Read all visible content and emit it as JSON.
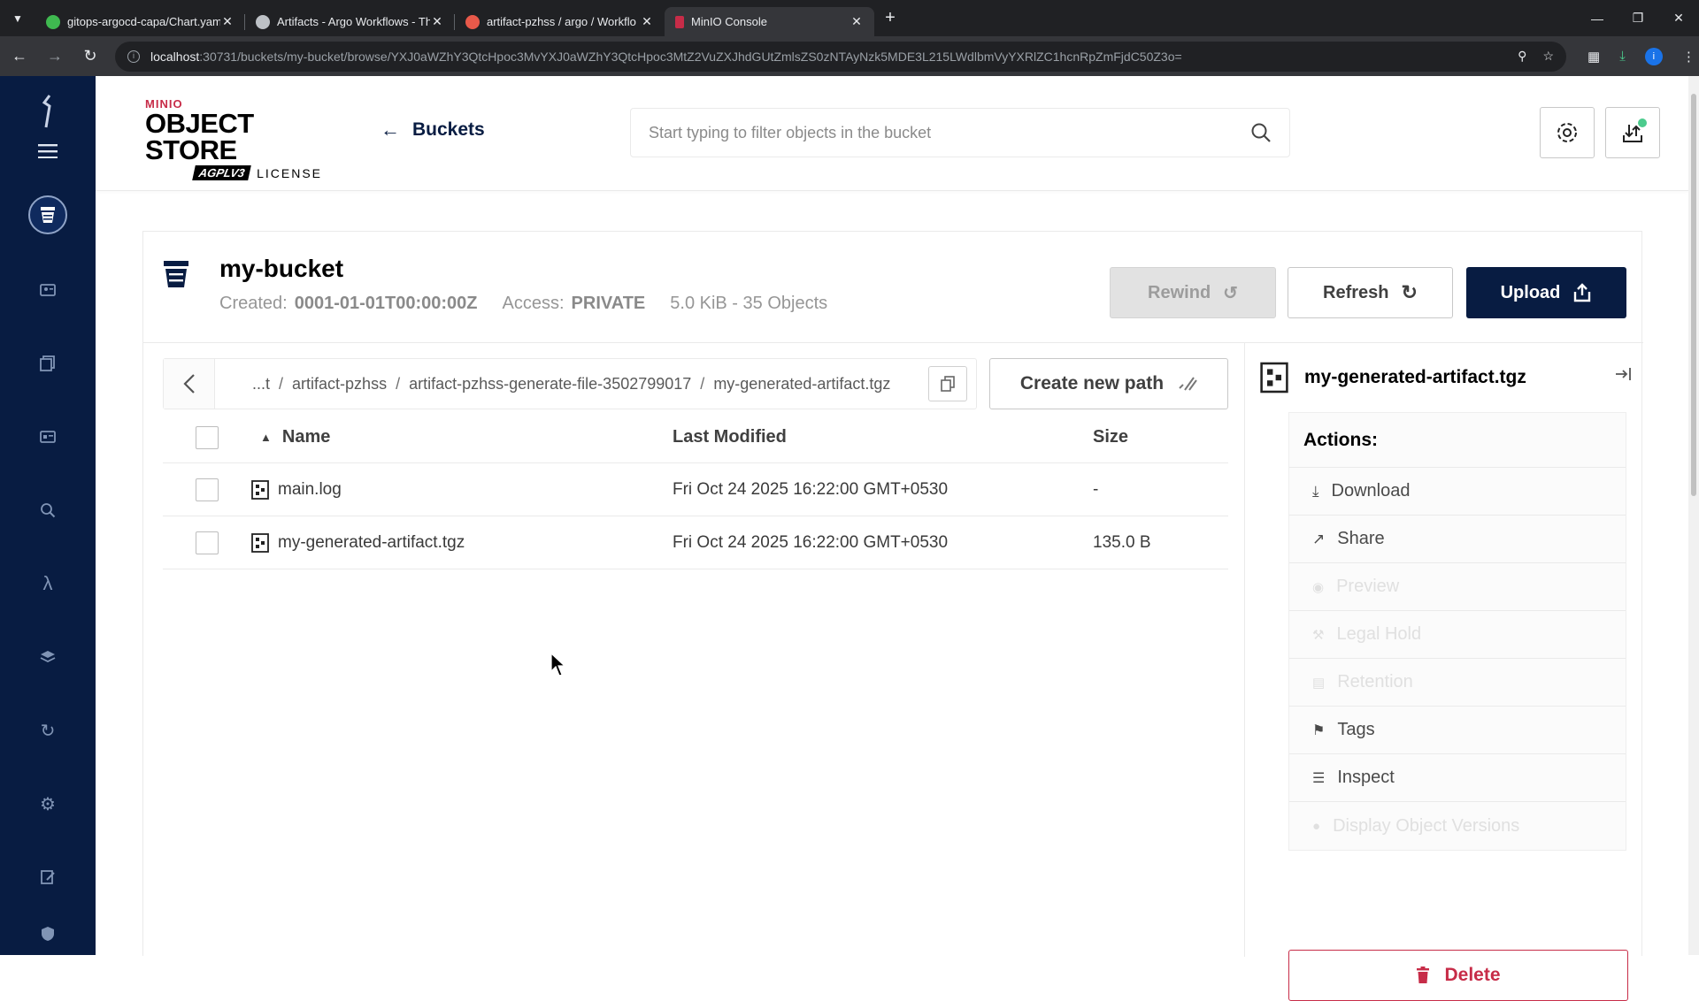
{
  "browser": {
    "tabs": [
      {
        "title": "gitops-argocd-capa/Chart.yaml",
        "favicon_color": "#3fb950",
        "active": false
      },
      {
        "title": "Artifacts - Argo Workflows - Th",
        "favicon_color": "#bdc1c6",
        "active": false
      },
      {
        "title": "artifact-pzhss / argo / Workflo",
        "favicon_color": "#e8594a",
        "active": false
      },
      {
        "title": "MinIO Console",
        "favicon_color": "#c72c48",
        "active": true
      }
    ],
    "url_host": "localhost",
    "url_rest": ":30731/buckets/my-bucket/browse/YXJ0aWZhY3QtcHpoc3MvYXJ0aWZhY3QtcHpoc3MtZ2VuZXJhdGUtZmlsZS0zNTAyNzk5MDE3L215LWdlbmVyYXRlZC1hcnRpZmFjdC50Z3o="
  },
  "header": {
    "logo": {
      "brand": "MINIO",
      "product": "OBJECT STORE",
      "badge": "AGPLV3",
      "license": "LICENSE"
    },
    "back_label": "Buckets",
    "search_placeholder": "Start typing to filter objects in the bucket"
  },
  "bucket": {
    "name": "my-bucket",
    "created_label": "Created:",
    "created_value": "0001-01-01T00:00:00Z",
    "access_label": "Access:",
    "access_value": "PRIVATE",
    "summary": "5.0 KiB - 35 Objects"
  },
  "buttons": {
    "rewind": "Rewind",
    "refresh": "Refresh",
    "upload": "Upload",
    "create_new_path": "Create new path",
    "delete": "Delete"
  },
  "breadcrumb": {
    "items": [
      "...t",
      "artifact-pzhss",
      "artifact-pzhss-generate-file-3502799017",
      "my-generated-artifact.tgz"
    ],
    "separator": "/"
  },
  "table": {
    "headers": {
      "name": "Name",
      "modified": "Last Modified",
      "size": "Size"
    },
    "rows": [
      {
        "name": "main.log",
        "modified": "Fri Oct 24 2025 16:22:00 GMT+0530",
        "size": "-"
      },
      {
        "name": "my-generated-artifact.tgz",
        "modified": "Fri Oct 24 2025 16:22:00 GMT+0530",
        "size": "135.0 B"
      }
    ]
  },
  "detail": {
    "title": "my-generated-artifact.tgz",
    "actions_label": "Actions:",
    "actions": [
      {
        "label": "Download",
        "icon": "download-icon",
        "enabled": true
      },
      {
        "label": "Share",
        "icon": "share-icon",
        "enabled": true
      },
      {
        "label": "Preview",
        "icon": "eye-icon",
        "enabled": false
      },
      {
        "label": "Legal Hold",
        "icon": "hammer-icon",
        "enabled": false
      },
      {
        "label": "Retention",
        "icon": "retention-icon",
        "enabled": false
      },
      {
        "label": "Tags",
        "icon": "tag-icon",
        "enabled": true
      },
      {
        "label": "Inspect",
        "icon": "inspect-icon",
        "enabled": true
      },
      {
        "label": "Display Object Versions",
        "icon": "versions-icon",
        "enabled": false
      }
    ]
  },
  "colors": {
    "sidebar": "#081c42",
    "primary": "#081c42",
    "danger": "#c72c48",
    "status_dot": "#4ccb8d"
  }
}
